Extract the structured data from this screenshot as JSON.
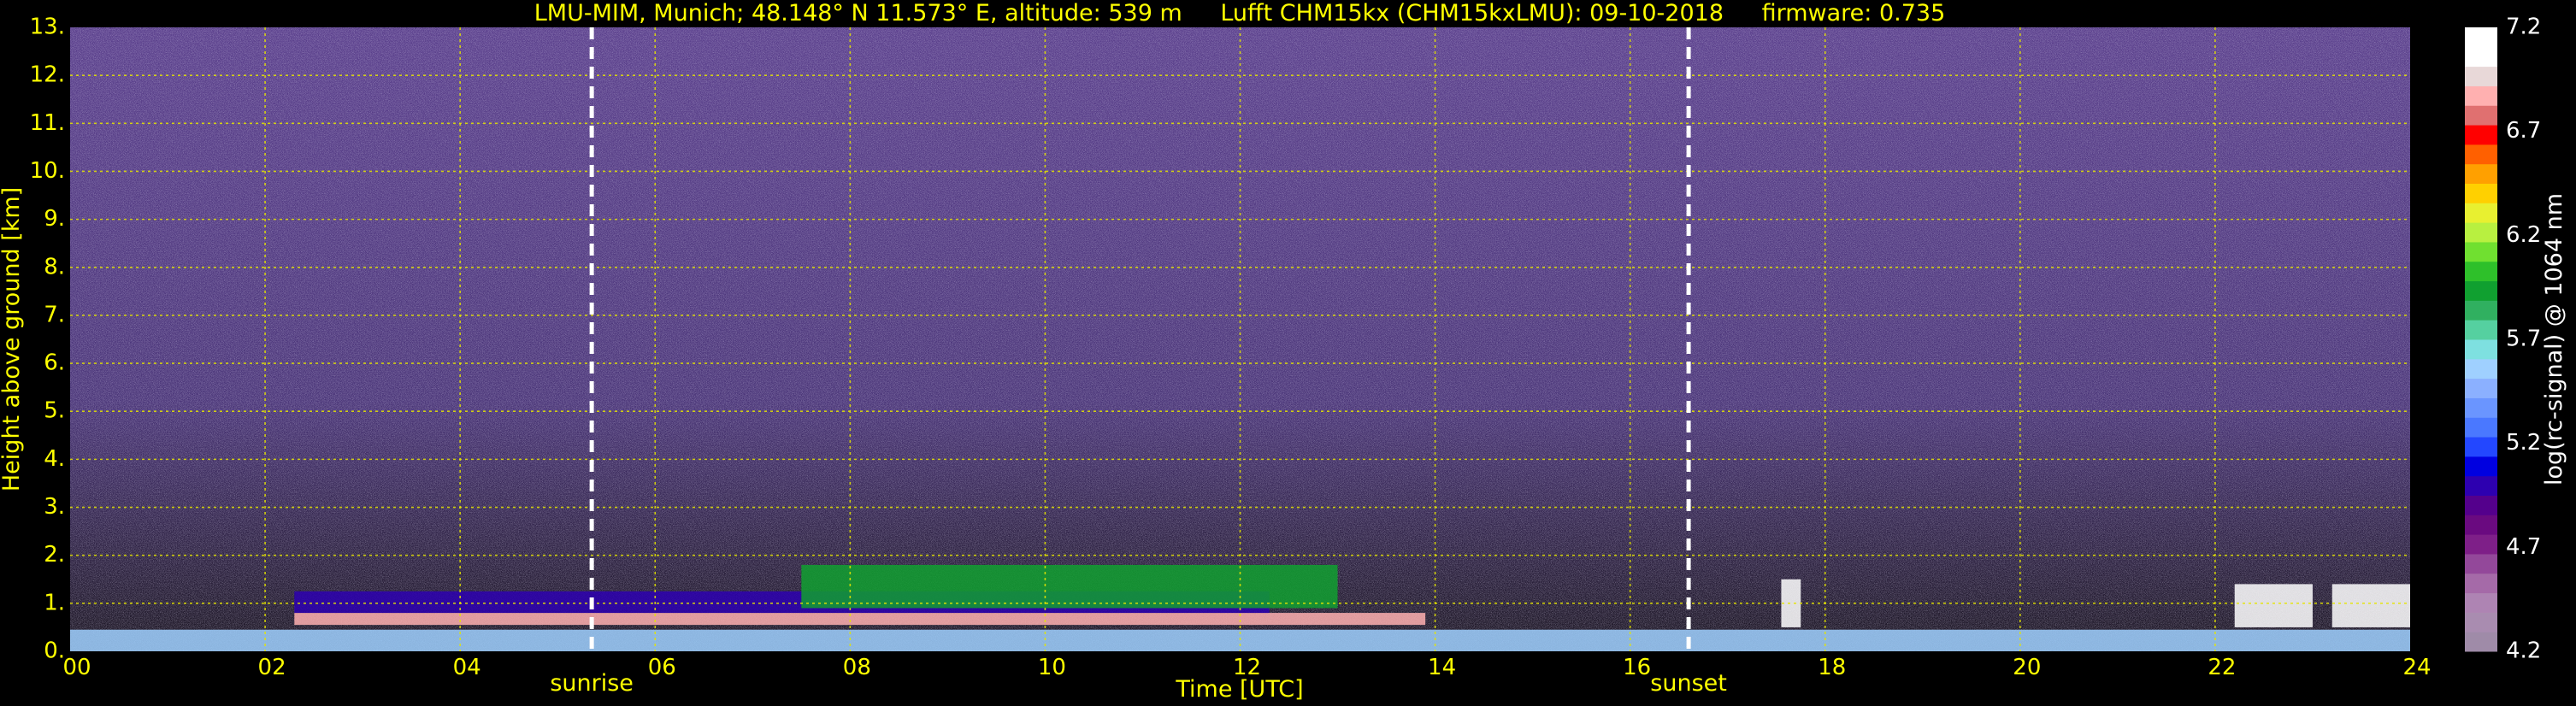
{
  "title": {
    "site": "LMU-MIM, Munich; 48.148° N 11.573° E, altitude: 539 m",
    "instrument": "Lufft CHM15kx (CHM15kxLMU): 09-10-2018",
    "firmware": "firmware: 0.735"
  },
  "chart_data": {
    "type": "heatmap",
    "xlabel": "Time [UTC]",
    "ylabel": "Height above ground [km]",
    "xlim": [
      0,
      24
    ],
    "ylim": [
      0,
      13
    ],
    "x_ticks": [
      "00",
      "02",
      "04",
      "06",
      "08",
      "10",
      "12",
      "14",
      "16",
      "18",
      "20",
      "22",
      "24"
    ],
    "x_tick_values": [
      0,
      2,
      4,
      6,
      8,
      10,
      12,
      14,
      16,
      18,
      20,
      22,
      24
    ],
    "y_ticks": [
      "0.",
      "1.",
      "2.",
      "3.",
      "4.",
      "5.",
      "6.",
      "7.",
      "8.",
      "9.",
      "10.",
      "11.",
      "12.",
      "13."
    ],
    "y_tick_values": [
      0,
      1,
      2,
      3,
      4,
      5,
      6,
      7,
      8,
      9,
      10,
      11,
      12,
      13
    ],
    "grid": true,
    "colorbar": {
      "label": "log(rc-signal) @ 1064 nm",
      "range": [
        4.2,
        7.2
      ],
      "ticks": [
        "4.2",
        "4.7",
        "5.2",
        "5.7",
        "6.2",
        "6.7",
        "7.2"
      ],
      "tick_values": [
        4.2,
        4.7,
        5.2,
        5.7,
        6.2,
        6.7,
        7.2
      ],
      "colors": [
        "#9f8ba8",
        "#a98cb0",
        "#ae84b3",
        "#a56aa8",
        "#93489a",
        "#7e1f88",
        "#6a0a80",
        "#54008c",
        "#2d00b0",
        "#0000e0",
        "#2347ff",
        "#4a78ff",
        "#6a95ff",
        "#8bb0ff",
        "#9fd0ff",
        "#7ee0e0",
        "#55d0a0",
        "#30b060",
        "#10a030",
        "#2ec02a",
        "#70e030",
        "#b8f040",
        "#e8f030",
        "#ffd000",
        "#ffa000",
        "#ff6000",
        "#ff0000",
        "#e07070",
        "#ffb0b0",
        "#e8d8d8",
        "#ffffff",
        "#ffffff"
      ]
    },
    "events": [
      {
        "label": "sunrise",
        "time": 5.35
      },
      {
        "label": "sunset",
        "time": 16.6
      }
    ],
    "features": [
      {
        "name": "surface layer",
        "t0": 0,
        "t1": 24,
        "h0": 0.0,
        "h1": 0.45,
        "value": 5.6
      },
      {
        "name": "boundary layer top",
        "t0": 2.3,
        "t1": 13.9,
        "h0": 0.55,
        "h1": 0.8,
        "value": 6.9
      },
      {
        "name": "residual layer",
        "t0": 2.3,
        "t1": 12.3,
        "h0": 0.8,
        "h1": 1.25,
        "value": 5.0
      },
      {
        "name": "convective layer",
        "t0": 7.5,
        "t1": 13.0,
        "h0": 0.9,
        "h1": 1.8,
        "value": 5.9
      },
      {
        "name": "cloud",
        "t0": 17.55,
        "t1": 17.75,
        "h0": 0.5,
        "h1": 1.5,
        "value": 7.1
      },
      {
        "name": "cloud",
        "t0": 22.2,
        "t1": 23.0,
        "h0": 0.5,
        "h1": 1.4,
        "value": 7.1
      },
      {
        "name": "cloud",
        "t0": 23.2,
        "t1": 24,
        "h0": 0.5,
        "h1": 1.4,
        "value": 7.1
      }
    ]
  }
}
